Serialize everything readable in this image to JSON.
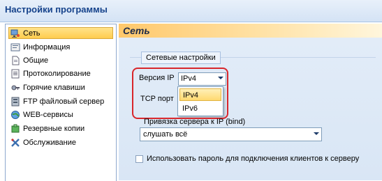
{
  "window": {
    "title": "Настройки программы"
  },
  "sidebar": {
    "items": [
      {
        "label": "Сеть",
        "icon": "network-icon",
        "selected": true
      },
      {
        "label": "Информация",
        "icon": "info-icon",
        "selected": false
      },
      {
        "label": "Общие",
        "icon": "general-icon",
        "selected": false
      },
      {
        "label": "Протоколирование",
        "icon": "log-icon",
        "selected": false
      },
      {
        "label": "Горячие клавиши",
        "icon": "hotkeys-icon",
        "selected": false
      },
      {
        "label": "FTP файловый сервер",
        "icon": "ftp-server-icon",
        "selected": false
      },
      {
        "label": "WEB-сервисы",
        "icon": "web-services-icon",
        "selected": false
      },
      {
        "label": "Резервные копии",
        "icon": "backup-icon",
        "selected": false
      },
      {
        "label": "Обслуживание",
        "icon": "maintenance-icon",
        "selected": false
      }
    ]
  },
  "main": {
    "header": "Сеть",
    "group_label": "Сетевые настройки",
    "ip_version": {
      "label": "Версия IP",
      "value": "IPv4",
      "options": [
        "IPv4",
        "IPv6"
      ],
      "selected_index": 0
    },
    "tcp_port": {
      "label": "TCP порт"
    },
    "bind": {
      "label": "Привязка сервера к IP (bind)",
      "value": "слушать всё"
    },
    "password_checkbox": {
      "label": "Использовать пароль для подключения клиентов к серверу",
      "checked": false
    }
  },
  "colors": {
    "accent": "#ffcc4d",
    "header_text": "#15428b",
    "highlight": "#d8262b",
    "panel_bg": "#dce8f6"
  }
}
